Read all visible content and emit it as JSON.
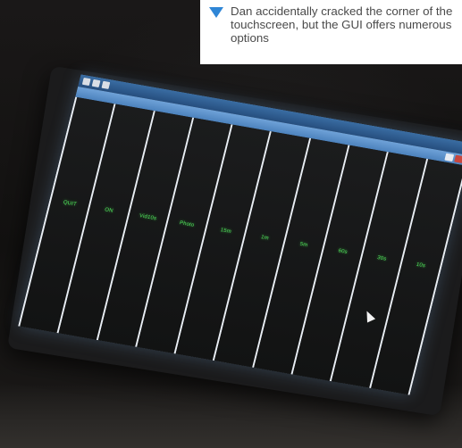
{
  "caption": {
    "text": "Dan accidentally cracked the corner of the touchscreen, but the GUI offers numerous options",
    "arrow_color": "#2f86d6"
  },
  "screen": {
    "accent": "#4fe05a",
    "buttons": [
      {
        "label": "QUIT"
      },
      {
        "label": "ON"
      },
      {
        "label": "Vid10s"
      },
      {
        "label": "Photo"
      },
      {
        "label": "15m"
      },
      {
        "label": "1m"
      },
      {
        "label": "5m"
      },
      {
        "label": "60s"
      },
      {
        "label": "30s"
      },
      {
        "label": "10s"
      }
    ]
  }
}
